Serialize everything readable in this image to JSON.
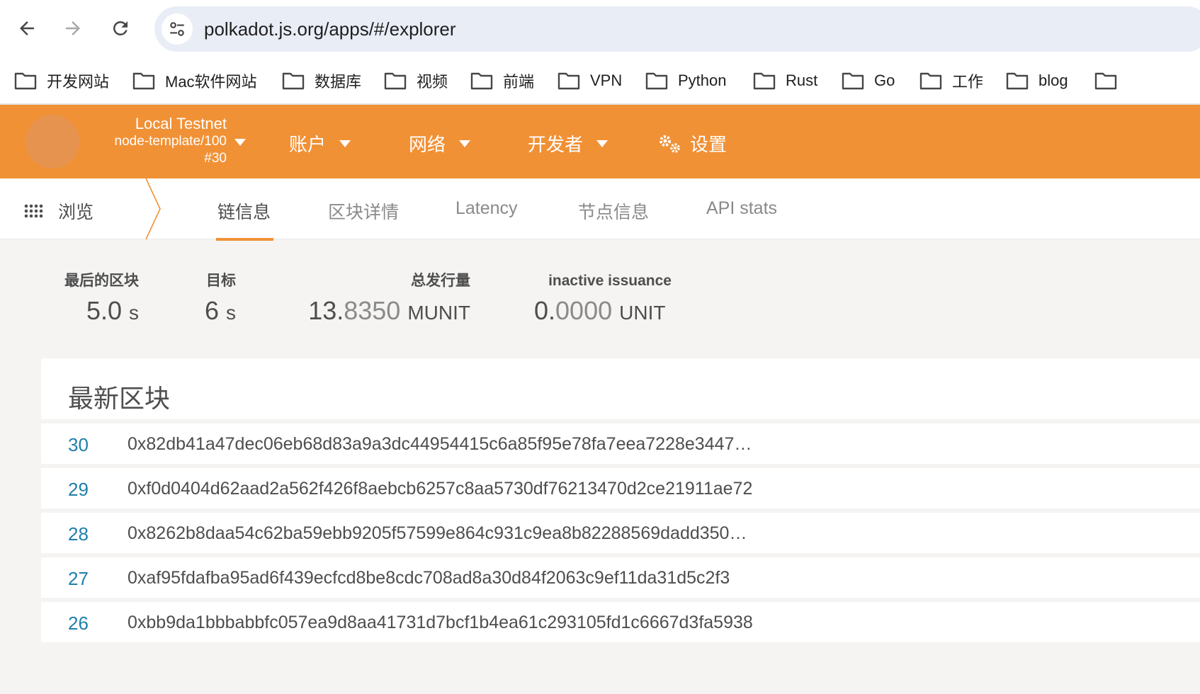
{
  "browser": {
    "url": "polkadot.js.org/apps/#/explorer",
    "bookmarks": [
      "开发网站",
      "Mac软件网站",
      "数据库",
      "视频",
      "前端",
      "VPN",
      "Python",
      "Rust",
      "Go",
      "工作",
      "blog"
    ]
  },
  "header": {
    "chain_name": "Local Testnet",
    "runtime": "node-template/100",
    "block": "#30",
    "menu": [
      "账户",
      "网络",
      "开发者",
      "设置"
    ]
  },
  "tabs": {
    "browse_label": "浏览",
    "items": [
      "链信息",
      "区块详情",
      "Latency",
      "节点信息",
      "API stats"
    ]
  },
  "summary": {
    "last_block": {
      "label": "最后的区块",
      "value": "5.0",
      "unit": "s"
    },
    "target": {
      "label": "目标",
      "value": "6",
      "unit": "s"
    },
    "total_issuance": {
      "label": "总发行量",
      "value_main": "13.",
      "value_dim": "8350",
      "unit": "MUNIT"
    },
    "inactive_issuance": {
      "label": "inactive issuance",
      "value_main": "0.",
      "value_dim": "0000",
      "unit": "UNIT"
    }
  },
  "recent_blocks": {
    "title": "最新区块",
    "rows": [
      {
        "number": "30",
        "hash": "0x82db41a47dec06eb68d83a9a3dc44954415c6a85f95e78fa7eea7228e3447…"
      },
      {
        "number": "29",
        "hash": "0xf0d0404d62aad2a562f426f8aebcb6257c8aa5730df76213470d2ce21911ae72"
      },
      {
        "number": "28",
        "hash": "0x8262b8daa54c62ba59ebb9205f57599e864c931c9ea8b82288569dadd350…"
      },
      {
        "number": "27",
        "hash": "0xaf95fdafba95ad6f439ecfcd8be8cdc708ad8a30d84f2063c9ef11da31d5c2f3"
      },
      {
        "number": "26",
        "hash": "0xbb9da1bbbabbfc057ea9d8aa41731d7bcf1b4ea61c293105fd1c6667d3fa5938"
      }
    ]
  },
  "colors": {
    "accent": "#f19135",
    "link": "#1f7fab"
  }
}
